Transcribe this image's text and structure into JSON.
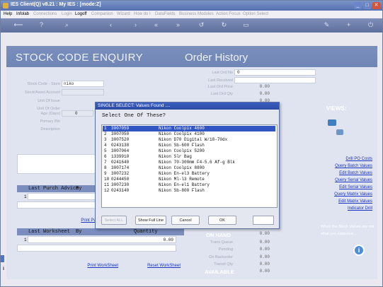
{
  "window": {
    "title": "IES Client(Q) v8.21 : My IES :        [mode:Z]"
  },
  "window_buttons": [
    "_",
    "□",
    "✕"
  ],
  "menu": [
    {
      "label": "Help",
      "enabled": true
    },
    {
      "label": "Infolab",
      "enabled": true
    },
    {
      "label": "Connections",
      "enabled": false
    },
    {
      "label": "Login",
      "enabled": false
    },
    {
      "label": "Logoff",
      "enabled": true
    },
    {
      "label": "Companion",
      "enabled": false
    },
    {
      "label": "Wizard",
      "enabled": false
    },
    {
      "label": "How do I",
      "enabled": false
    },
    {
      "label": "DataFields",
      "enabled": false
    },
    {
      "label": "Business Modules",
      "enabled": false
    },
    {
      "label": "Action Focus",
      "enabled": false
    },
    {
      "label": "Option Select",
      "enabled": false
    }
  ],
  "toolbar_icons": [
    "back-arrow-icon",
    "help-icon",
    "search-icon",
    "previous-icon",
    "next-icon",
    "first-icon",
    "last-icon",
    "undo-icon",
    "redo-icon",
    "save-icon",
    "edit-icon",
    "add-icon",
    "exit-icon"
  ],
  "header": {
    "title": "STOCK  CODE  ENQUIRY",
    "subtitle": "Order History"
  },
  "form": {
    "stock_code_label": "Stock Code - Store",
    "stock_code_value": "niko",
    "stock_asset_label": "Stock/Asset Account",
    "unit_of_issue_label": "Unit Of Issue",
    "unit_of_order_label": "Unit Of Order",
    "age_label": "Age (Days)",
    "age_value": "0",
    "primary_bin_label": "Primary Bin",
    "description_label": "Description",
    "detail_label": "Detail"
  },
  "order_fields": {
    "last_ord_no_label": "Last Ord No",
    "last_ord_no_value": "0",
    "last_received_label": "Last Received",
    "last_ord_price_label": "Last Ord Price",
    "last_ord_price_value": "0.00",
    "last_ord_qty_label": "Last Ord Qty",
    "last_ord_qty_value": "0.00",
    "extra_value": "0.00"
  },
  "side": {
    "views_label": "VIEWS:",
    "links": [
      "Drill PO Costs",
      "Query Batch Values",
      "Edit Batch Values",
      "Query Serial Values",
      "Edit Serial Values",
      "Query Matrix Values",
      "Edit Matrix Values",
      "Indicator Drill"
    ],
    "note": "When the Stock Values are not what you expected..."
  },
  "purch_advice": {
    "header": "Last Purch Advice",
    "by": "By",
    "row_no": "1",
    "print_link": "Print Purch..."
  },
  "worksheet": {
    "header": "Last Worksheet",
    "by": "By",
    "qty_label": "Quantity",
    "row_no": "1",
    "qty_value": "0.00",
    "print_link": "Print WorkSheet",
    "reset_link": "Reset WorkSheet"
  },
  "stock": {
    "on_hand_label": "ON HAND",
    "on_hand_value": "0.00",
    "rows": [
      {
        "label": "Trans Queue",
        "value": "0.00"
      },
      {
        "label": "Pending",
        "value": "0.00"
      },
      {
        "label": "On Backorder",
        "value": "0.00"
      },
      {
        "label": "Transit Qty",
        "value": "0.00"
      }
    ],
    "available_label": "AVAILABLE",
    "available_value": "0.00"
  },
  "dialog": {
    "title": "SINGLE SELECT: Values Found ....",
    "prompt": "Select One Of These?",
    "items": [
      {
        "n": "1",
        "code": "3007059",
        "desc": "Nikon Coolpix 4600",
        "selected": true
      },
      {
        "n": "2",
        "code": "3007050",
        "desc": "Nikon Coolpix 4100",
        "selected": false
      },
      {
        "n": "3",
        "code": "3007520",
        "desc": "Nikon D70 Digital W/18-70dx",
        "selected": false
      },
      {
        "n": "4",
        "code": "0243138",
        "desc": "Nikon Sb-600 Flash",
        "selected": false
      },
      {
        "n": "5",
        "code": "3007064",
        "desc": "Nikon Coolpix 5200",
        "selected": false
      },
      {
        "n": "6",
        "code": "1339910",
        "desc": "Nikon Slr Bag",
        "selected": false
      },
      {
        "n": "7",
        "code": "0241640",
        "desc": "Nikon 70-300mm F4-5.6 Af-g Blk",
        "selected": false
      },
      {
        "n": "8",
        "code": "3007174",
        "desc": "Nikon Coolpix 8800",
        "selected": false
      },
      {
        "n": "9",
        "code": "3007232",
        "desc": "Nikon En-el3 Battery",
        "selected": false
      },
      {
        "n": "10",
        "code": "0244450",
        "desc": "Nikon Ml-l3 Remote",
        "selected": false
      },
      {
        "n": "11",
        "code": "3007230",
        "desc": "Nikon En-el1 Battery",
        "selected": false
      },
      {
        "n": "12",
        "code": "0243140",
        "desc": "Nikon Sb-800 Flash",
        "selected": false
      }
    ],
    "buttons": {
      "select_all": "Select ALL",
      "show_full_line": "Show Full Line",
      "cancel": "Cancel",
      "ok": "OK"
    },
    "search_value": ""
  }
}
